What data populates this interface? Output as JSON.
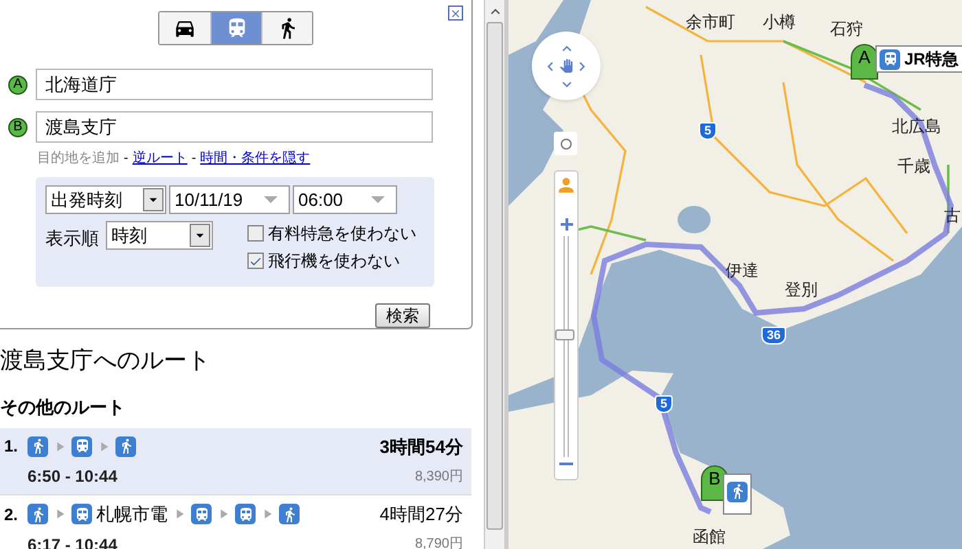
{
  "modes": [
    {
      "kind": "car",
      "selected": false
    },
    {
      "kind": "transit",
      "selected": true
    },
    {
      "kind": "walk",
      "selected": false
    }
  ],
  "origin": {
    "marker": "A",
    "value": "北海道庁"
  },
  "destination": {
    "marker": "B",
    "value": "渡島支庁"
  },
  "links": {
    "add_destination": "目的地を追加",
    "separators": [
      "-",
      "-"
    ],
    "reverse": "逆ルート",
    "hide_options": "時間・条件を隠す"
  },
  "options": {
    "time_type": "出発時刻",
    "date": "10/11/19",
    "time": "06:00",
    "sort_label": "表示順",
    "sort": "時刻",
    "checkboxes": [
      {
        "label": "有料特急を使わない",
        "checked": false
      },
      {
        "label": "飛行機を使わない",
        "checked": true
      }
    ],
    "search_button": "検索"
  },
  "results_title": "渡島支庁へのルート",
  "other_routes_title": "その他のルート",
  "routes": [
    {
      "number": "1.",
      "selected": true,
      "steps": [
        {
          "kind": "walk"
        },
        {
          "kind": "train"
        },
        {
          "kind": "walk"
        }
      ],
      "duration": "3時間54分",
      "times": "6:50 - 10:44",
      "fare": "8,390円"
    },
    {
      "number": "2.",
      "selected": false,
      "steps": [
        {
          "kind": "walk"
        },
        {
          "kind": "train",
          "label": "札幌市電"
        },
        {
          "kind": "train"
        },
        {
          "kind": "train"
        },
        {
          "kind": "walk"
        }
      ],
      "duration": "4時間27分",
      "times": "6:17 - 10:44",
      "fare": "8,790円"
    }
  ],
  "map": {
    "labels": [
      "余市町",
      "小樽",
      "石狩",
      "北広島",
      "千歳",
      "古",
      "伊達",
      "登別",
      "函館"
    ],
    "road_signs": [
      "5",
      "36",
      "5"
    ],
    "markers": [
      {
        "letter": "A"
      },
      {
        "letter": "B"
      }
    ],
    "callout": "JR特急",
    "zoom": {
      "level": 0.58
    }
  }
}
